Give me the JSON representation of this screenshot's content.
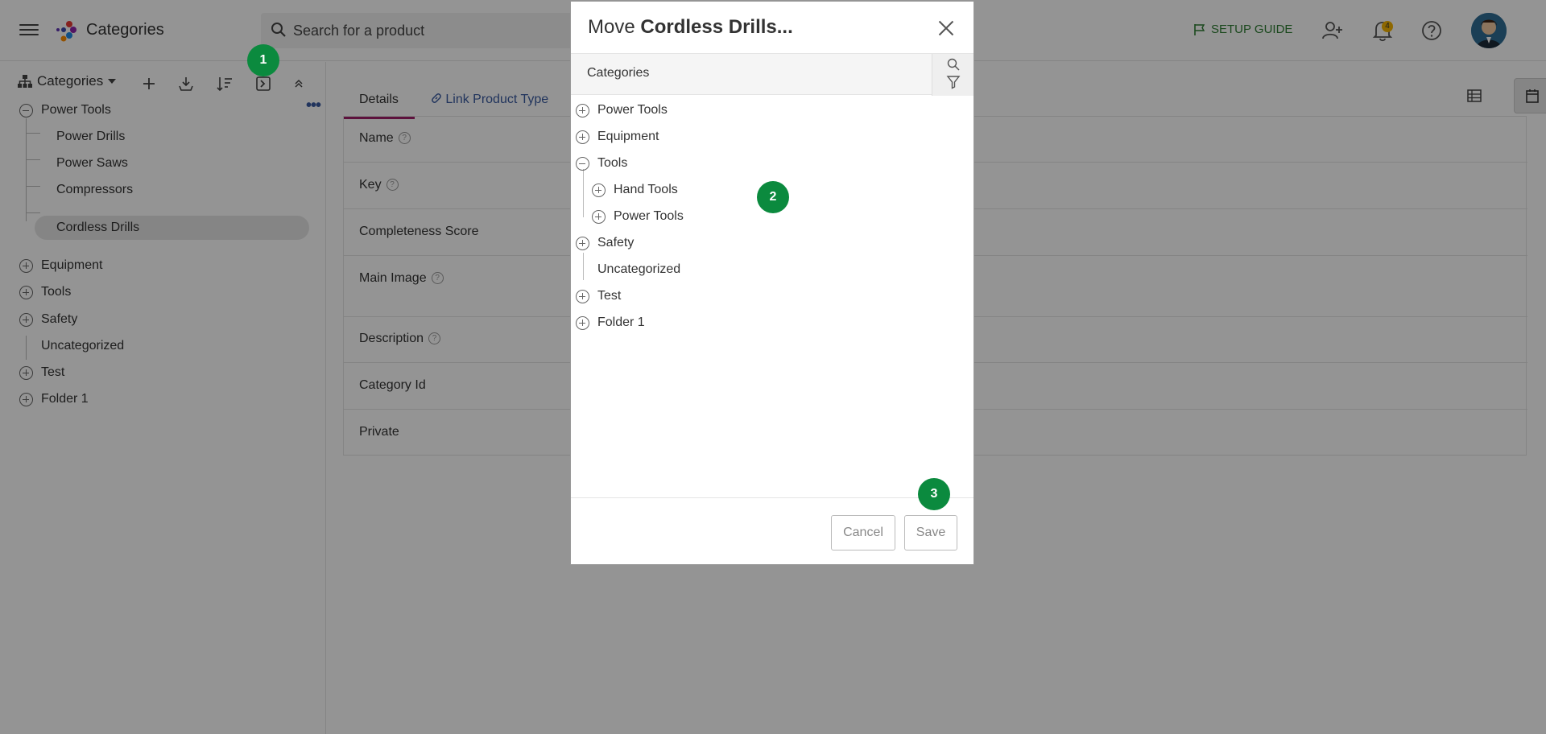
{
  "header": {
    "app_title": "Categories",
    "search_placeholder": "Search for a product",
    "setup_guide": "SETUP GUIDE",
    "notification_count": "4"
  },
  "sidebar": {
    "selector_label": "Categories",
    "tree": [
      {
        "label": "Power Tools",
        "expanded": true
      },
      {
        "label": "Power Drills"
      },
      {
        "label": "Power Saws"
      },
      {
        "label": "Compressors"
      },
      {
        "label": "Cordless Drills",
        "selected": true
      },
      {
        "label": "Equipment"
      },
      {
        "label": "Tools"
      },
      {
        "label": "Safety"
      },
      {
        "label": "Uncategorized"
      },
      {
        "label": "Test"
      },
      {
        "label": "Folder 1"
      }
    ],
    "more_label": "•••"
  },
  "main": {
    "tabs": [
      {
        "label": "Details",
        "active": true
      },
      {
        "label": "Link Product Type"
      }
    ],
    "fields": [
      {
        "label": "Name",
        "help": true
      },
      {
        "label": "Key",
        "help": true
      },
      {
        "label": "Completeness Score"
      },
      {
        "label": "Main Image",
        "help": true
      },
      {
        "label": "Description",
        "help": true
      },
      {
        "label": "Category Id"
      },
      {
        "label": "Private"
      }
    ],
    "help_glyph": "?"
  },
  "modal": {
    "title_prefix": "Move ",
    "title_bold": "Cordless Drills...",
    "header_label": "Categories",
    "tree": [
      {
        "label": "Power Tools",
        "state": "collapsed"
      },
      {
        "label": "Equipment",
        "state": "collapsed"
      },
      {
        "label": "Tools",
        "state": "expanded"
      },
      {
        "label": "Hand Tools",
        "state": "collapsed"
      },
      {
        "label": "Power Tools",
        "state": "collapsed"
      },
      {
        "label": "Safety",
        "state": "collapsed"
      },
      {
        "label": "Uncategorized",
        "state": "leaf"
      },
      {
        "label": "Test",
        "state": "collapsed"
      },
      {
        "label": "Folder 1",
        "state": "collapsed"
      }
    ],
    "cancel_label": "Cancel",
    "save_label": "Save"
  },
  "step_badges": [
    "1",
    "2",
    "3"
  ],
  "colors": {
    "accent_tab": "#a0206a",
    "link": "#3a5ba0",
    "setup_green": "#2e7d32",
    "badge_green": "#0b8a3e",
    "notification": "#f4b400"
  }
}
